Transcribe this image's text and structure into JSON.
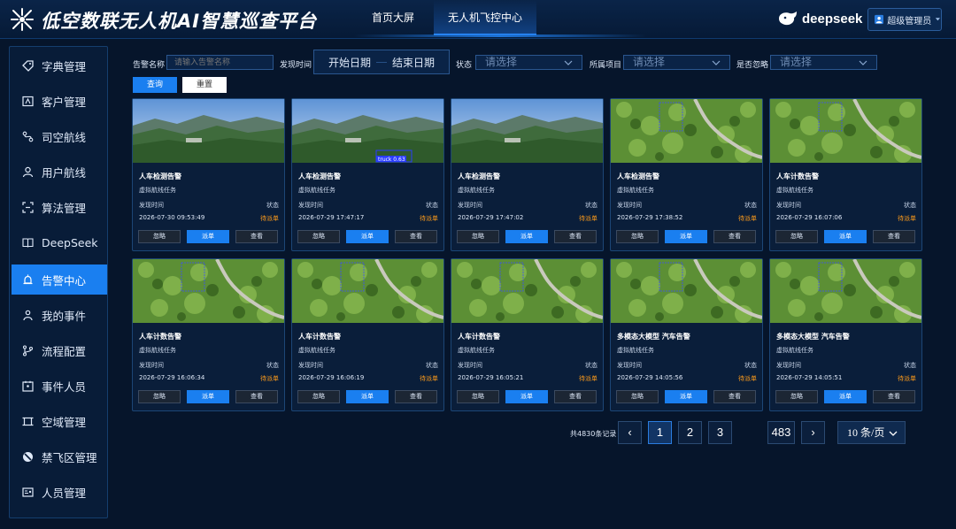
{
  "header": {
    "title": "低空数联无人机AI智慧巡查平台",
    "nav": [
      "首页大屏",
      "无人机飞控中心"
    ],
    "brand": "deepseek",
    "user": "超级管理员"
  },
  "sidebar": {
    "items": [
      {
        "label": "字典管理",
        "icon": "tag-icon"
      },
      {
        "label": "客户管理",
        "icon": "contact-card-icon"
      },
      {
        "label": "司空航线",
        "icon": "route-icon"
      },
      {
        "label": "用户航线",
        "icon": "user-icon"
      },
      {
        "label": "算法管理",
        "icon": "scan-icon"
      },
      {
        "label": "DeepSeek",
        "icon": "book-icon"
      },
      {
        "label": "告警中心",
        "icon": "alarm-icon",
        "active": true
      },
      {
        "label": "我的事件",
        "icon": "person-icon"
      },
      {
        "label": "流程配置",
        "icon": "branch-icon"
      },
      {
        "label": "事件人员",
        "icon": "calendar-person-icon"
      },
      {
        "label": "空域管理",
        "icon": "frame-icon"
      },
      {
        "label": "禁飞区管理",
        "icon": "no-entry-icon"
      },
      {
        "label": "人员管理",
        "icon": "id-card-icon"
      }
    ]
  },
  "filters": {
    "name_label": "告警名称",
    "name_placeholder": "请输入告警名称",
    "time_label": "发现时间",
    "start_date": "开始日期",
    "end_date": "结束日期",
    "status_label": "状态",
    "status_placeholder": "请选择",
    "project_label": "所属项目",
    "project_placeholder": "请选择",
    "ignore_label": "是否忽略",
    "ignore_placeholder": "请选择",
    "query_btn": "查询",
    "reset_btn": "重置"
  },
  "card_labels": {
    "found_time": "发现时间",
    "status": "状态",
    "ignore": "忽略",
    "dispatch": "派单",
    "view": "查看"
  },
  "alarms": [
    {
      "title": "人车检测告警",
      "task": "虚拟航线任务",
      "time": "2026-07-30 09:53:49",
      "status": "待派单",
      "scene": "mountain",
      "box": ""
    },
    {
      "title": "人车检测告警",
      "task": "虚拟航线任务",
      "time": "2026-07-29 17:47:17",
      "status": "待派单",
      "scene": "mountain",
      "box": "truck 0.63"
    },
    {
      "title": "人车检测告警",
      "task": "虚拟航线任务",
      "time": "2026-07-29 17:47:02",
      "status": "待派单",
      "scene": "mountain",
      "box": ""
    },
    {
      "title": "人车检测告警",
      "task": "虚拟航线任务",
      "time": "2026-07-29 17:38:52",
      "status": "待派单",
      "scene": "forest",
      "box": ""
    },
    {
      "title": "人车计数告警",
      "task": "虚拟航线任务",
      "time": "2026-07-29 16:07:06",
      "status": "待派单",
      "scene": "forest",
      "box": ""
    },
    {
      "title": "人车计数告警",
      "task": "虚拟航线任务",
      "time": "2026-07-29 16:06:34",
      "status": "待派单",
      "scene": "forest",
      "box": ""
    },
    {
      "title": "人车计数告警",
      "task": "虚拟航线任务",
      "time": "2026-07-29 16:06:19",
      "status": "待派单",
      "scene": "forest",
      "box": ""
    },
    {
      "title": "人车计数告警",
      "task": "虚拟航线任务",
      "time": "2026-07-29 16:05:21",
      "status": "待派单",
      "scene": "forest",
      "box": ""
    },
    {
      "title": "多模态大模型 汽车告警",
      "task": "虚拟航线任务",
      "time": "2026-07-29 14:05:56",
      "status": "待派单",
      "scene": "forest",
      "box": ""
    },
    {
      "title": "多模态大模型 汽车告警",
      "task": "虚拟航线任务",
      "time": "2026-07-29 14:05:51",
      "status": "待派单",
      "scene": "forest",
      "box": ""
    }
  ],
  "pagination": {
    "total": "共4830条记录",
    "pages": [
      "1",
      "2",
      "3"
    ],
    "current": "1",
    "last": "483",
    "prev": "‹",
    "next": "›",
    "per_page": "10 条/页"
  }
}
